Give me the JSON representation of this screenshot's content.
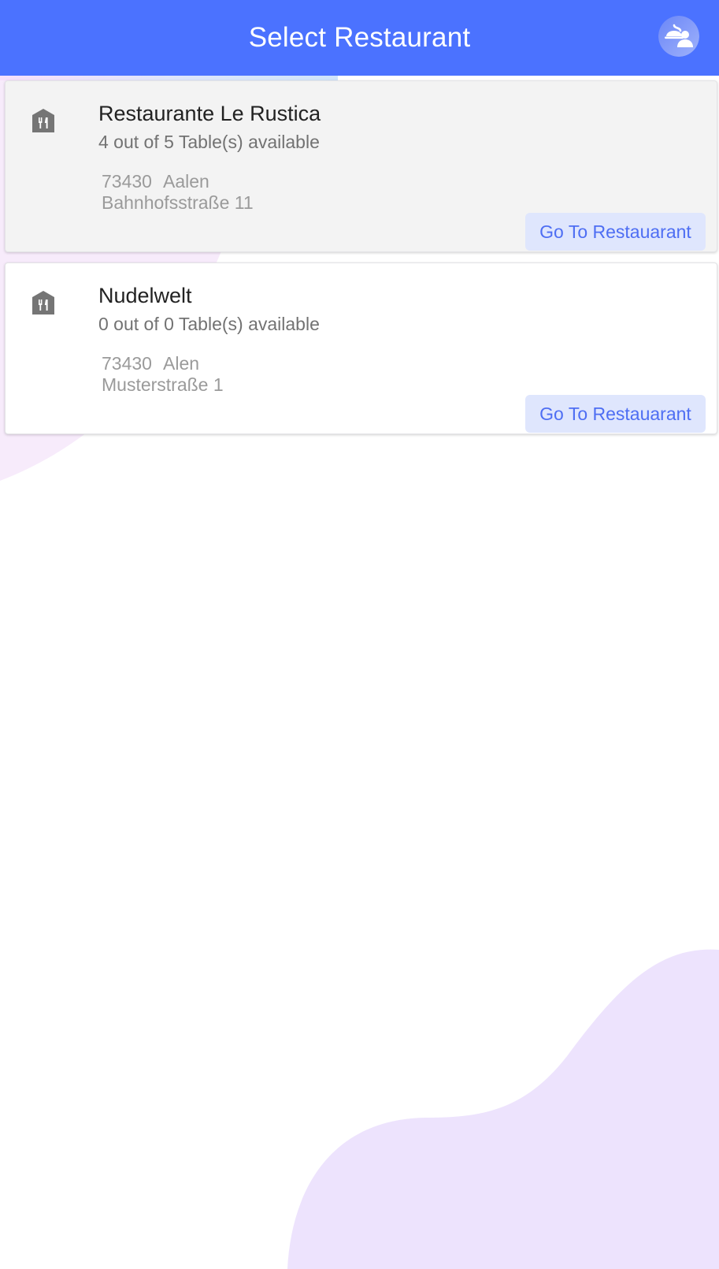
{
  "theme": {
    "primary": "#4b72ff",
    "button_bg": "#dfe6fd",
    "button_text": "#4e6ef3",
    "card_selected_bg": "#f3f3f3",
    "card_bg": "#ffffff",
    "blob_color": "#ede3fd",
    "blob_color_top": "#f7ebfb"
  },
  "appbar": {
    "title": "Select Restaurant",
    "avatar_icon": "waiter-serving-icon"
  },
  "progress": {
    "fraction": 0.47
  },
  "restaurants": [
    {
      "name": "Restaurante Le Rustica",
      "availability": "4 out of 5 Table(s) available",
      "zip": "73430",
      "city": "Aalen",
      "street": "Bahnhofsstraße 11",
      "button_label": "Go To Restauarant",
      "icon": "restaurant-icon",
      "selected": true
    },
    {
      "name": "Nudelwelt",
      "availability": "0 out of 0 Table(s) available",
      "zip": "73430",
      "city": "Alen",
      "street": "Musterstraße 1",
      "button_label": "Go To Restauarant",
      "icon": "restaurant-icon",
      "selected": false
    }
  ]
}
